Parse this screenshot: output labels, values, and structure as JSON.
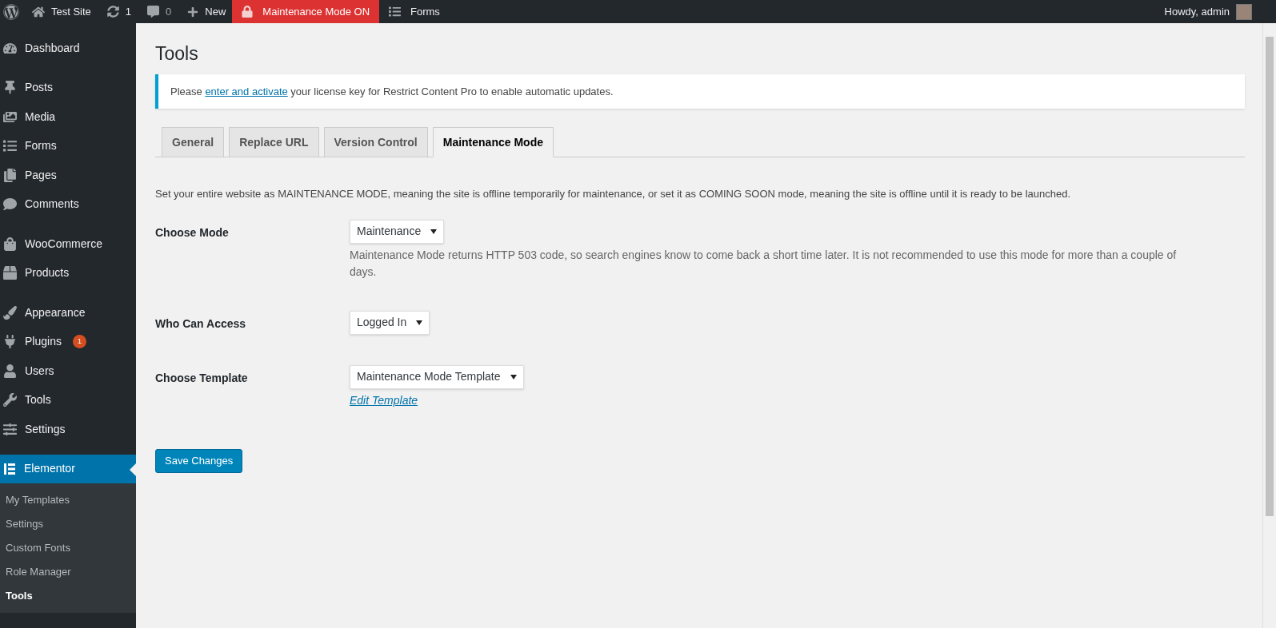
{
  "admin_bar": {
    "site": "Test Site",
    "updates": "1",
    "comments": "0",
    "new": "New",
    "maintenance": "Maintenance Mode ON",
    "forms": "Forms",
    "greeting": "Howdy, admin"
  },
  "sidebar": {
    "groups": [
      {
        "items": [
          {
            "label": "Dashboard",
            "selected": false
          }
        ]
      },
      {
        "items": [
          {
            "label": "Posts",
            "selected": false
          },
          {
            "label": "Media",
            "selected": false
          },
          {
            "label": "Forms",
            "selected": false
          },
          {
            "label": "Pages",
            "selected": false
          },
          {
            "label": "Comments",
            "selected": false
          }
        ]
      },
      {
        "items": [
          {
            "label": "WooCommerce",
            "selected": false
          },
          {
            "label": "Products",
            "selected": false
          }
        ]
      },
      {
        "items": [
          {
            "label": "Appearance",
            "selected": false
          },
          {
            "label": "Plugins",
            "selected": false,
            "badge": "1"
          },
          {
            "label": "Users",
            "selected": false
          },
          {
            "label": "Tools",
            "selected": false
          },
          {
            "label": "Settings",
            "selected": false
          }
        ]
      },
      {
        "items": [
          {
            "label": "Elementor",
            "selected": true,
            "children": [
              {
                "label": "My Templates",
                "selected": false
              },
              {
                "label": "Settings",
                "selected": false
              },
              {
                "label": "Custom Fonts",
                "selected": false
              },
              {
                "label": "Role Manager",
                "selected": false
              },
              {
                "label": "Tools",
                "selected": true
              }
            ]
          }
        ]
      }
    ]
  },
  "page_title": "Tools",
  "notice_parts": {
    "before": "Please ",
    "link": "enter and activate",
    "after": " your license key for Restrict Content Pro to enable automatic updates."
  },
  "tabs": [
    {
      "label": "General",
      "selected": false
    },
    {
      "label": "Replace URL",
      "selected": false
    },
    {
      "label": "Version Control",
      "selected": false
    },
    {
      "label": "Maintenance Mode",
      "selected": true
    }
  ],
  "intro": "Set your entire website as MAINTENANCE MODE, meaning the site is offline temporarily for maintenance, or set it as COMING SOON mode, meaning the site is offline until it is ready to be launched.",
  "fields": [
    {
      "label": "Choose Mode",
      "value": "Maintenance",
      "description": "Maintenance Mode returns HTTP 503 code, so search engines know to come back a short time later. It is not recommended to use this mode for more than a couple of days."
    },
    {
      "label": "Who Can Access",
      "value": "Logged In"
    },
    {
      "label": "Choose Template",
      "value": "Maintenance Mode Template",
      "link": "Edit Template"
    }
  ],
  "save_button": "Save Changes"
}
